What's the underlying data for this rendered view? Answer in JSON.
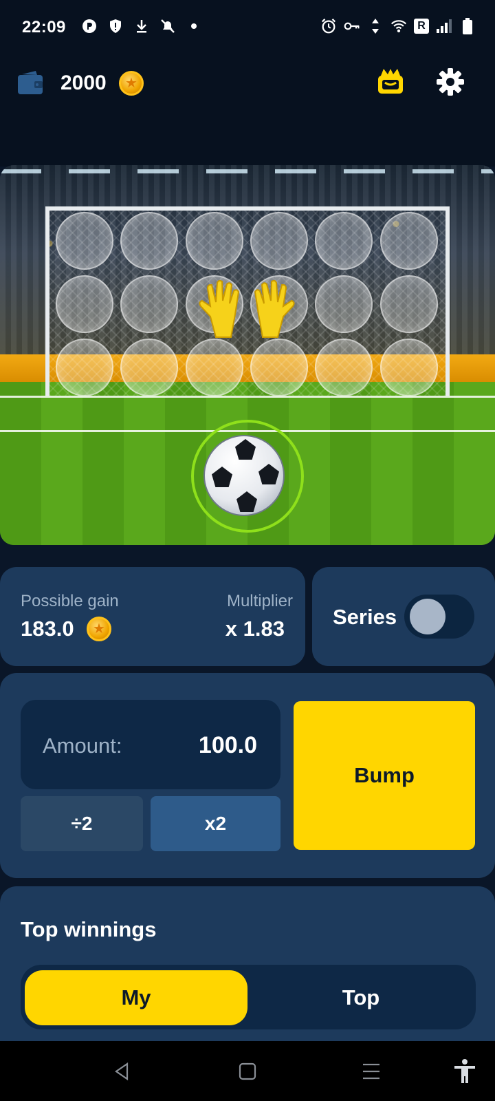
{
  "status_bar": {
    "time": "22:09",
    "left_icons": [
      "p-icon",
      "shield-icon",
      "download-icon",
      "muted-bell-icon",
      "dot-icon"
    ],
    "right_icons": [
      "alarm-icon",
      "key-icon",
      "data-arrows-icon",
      "wifi-icon",
      "r-badge-icon",
      "signal-icon",
      "battery-icon"
    ],
    "r_badge": "R"
  },
  "header": {
    "balance": "2000",
    "icons": [
      "wallet-icon",
      "coin-icon",
      "gift-icon",
      "gear-icon"
    ]
  },
  "game": {
    "target_rows": 3,
    "target_cols": 6,
    "icons": [
      "goalkeeper-gloves-icon",
      "soccer-ball-icon"
    ]
  },
  "stats": {
    "possible_gain_label": "Possible gain",
    "possible_gain_value": "183.0",
    "multiplier_label": "Multiplier",
    "multiplier_value": "x 1.83",
    "series_label": "Series",
    "series_enabled": false
  },
  "bet": {
    "amount_label": "Amount:",
    "amount_value": "100.0",
    "half_label": "÷2",
    "double_label": "x2",
    "bump_label": "Bump"
  },
  "top_winnings": {
    "title": "Top winnings",
    "tabs": [
      {
        "label": "My",
        "active": true
      },
      {
        "label": "Top",
        "active": false
      }
    ]
  },
  "colors": {
    "accent_yellow": "#ffd600",
    "card_bg": "#1d3a5c",
    "page_bg": "#0a1628"
  },
  "nav_bar": {
    "icons": [
      "back-icon",
      "home-icon",
      "recents-icon",
      "accessibility-icon"
    ]
  }
}
